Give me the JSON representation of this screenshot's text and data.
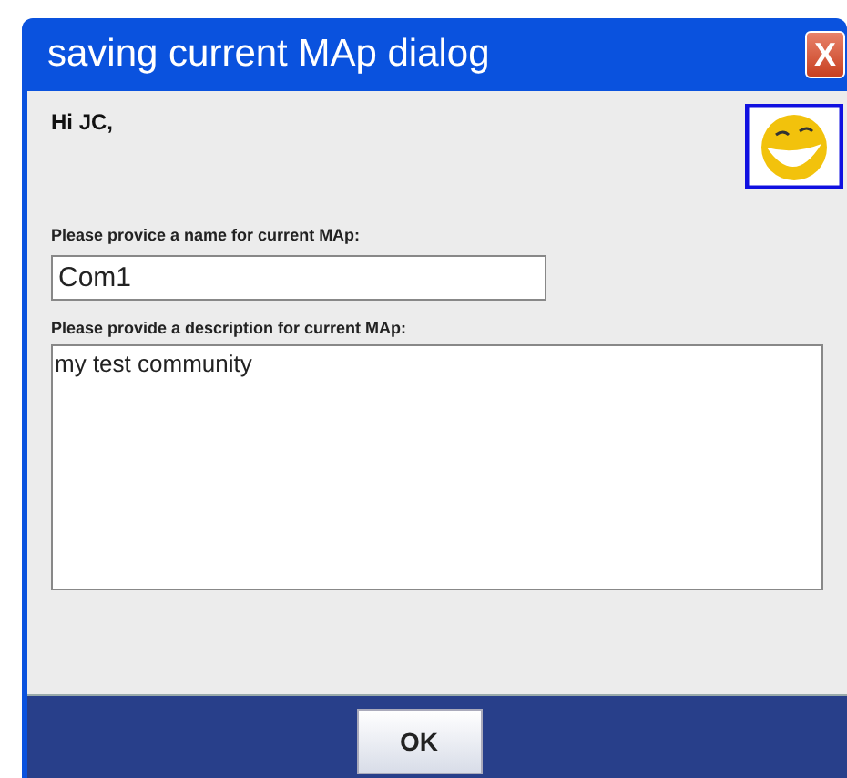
{
  "window": {
    "title": "saving current MAp dialog",
    "close": "X"
  },
  "greeting": "Hi JC,",
  "name_label": "Please provice a name for current MAp:",
  "name_value": "Com1",
  "description_label": "Please provide a  description for current MAp:",
  "description_value": "my test community",
  "buttons": [
    "OK"
  ]
}
